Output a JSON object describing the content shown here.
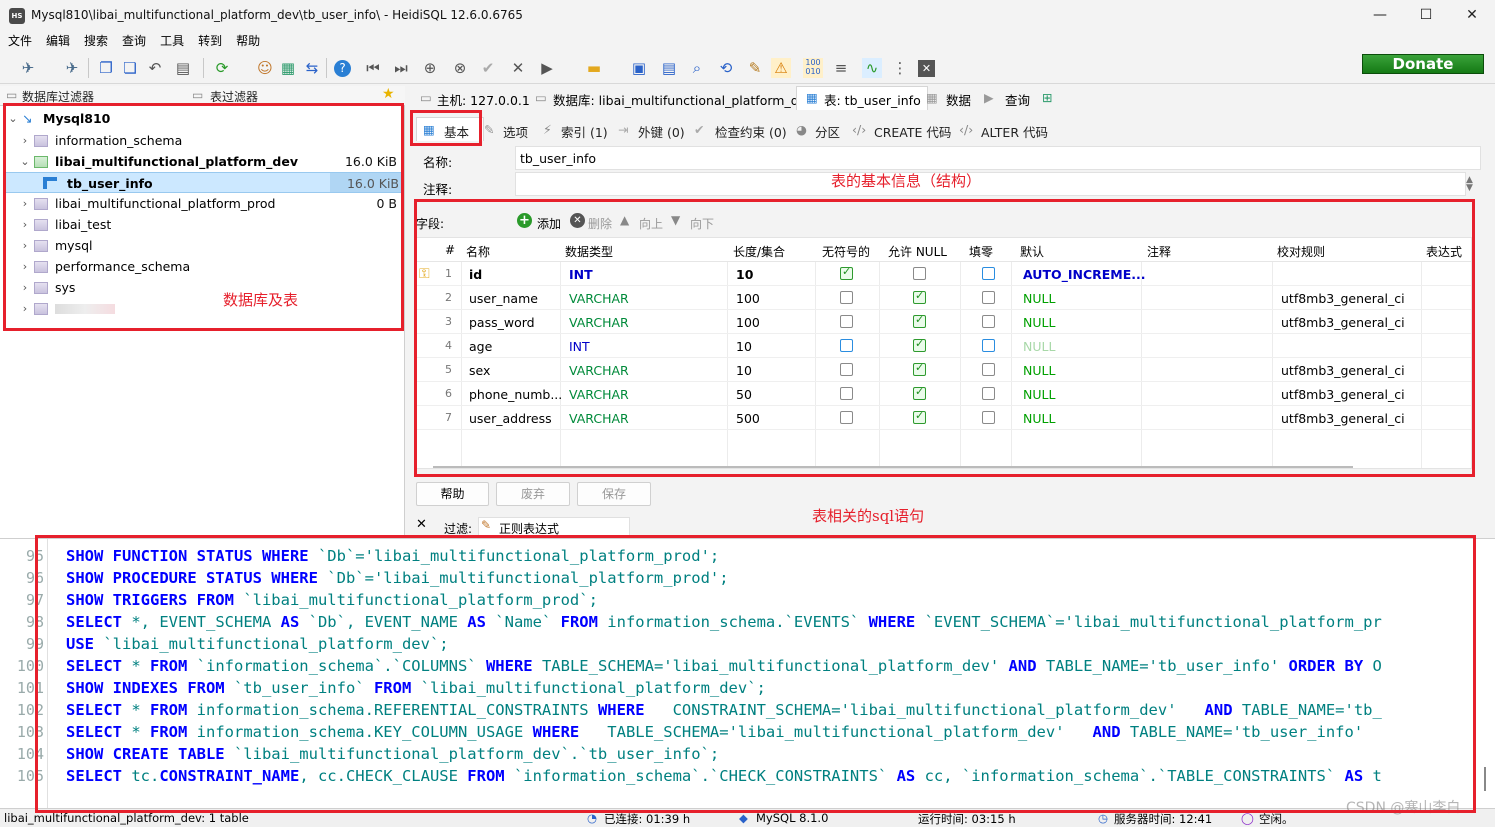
{
  "window": {
    "title": "Mysql810\\libai_multifunctional_platform_dev\\tb_user_info\\ - HeidiSQL 12.6.0.6765",
    "app_badge": "HS"
  },
  "menu": [
    "文件",
    "编辑",
    "搜索",
    "查询",
    "工具",
    "转到",
    "帮助"
  ],
  "donate_label": "Donate",
  "left_filters": {
    "db_filter": "数据库过滤器",
    "table_filter": "表过滤器"
  },
  "tree": {
    "root": "Mysql810",
    "items": [
      {
        "label": "information_schema",
        "size": ""
      },
      {
        "label": "libai_multifunctional_platform_dev",
        "size": "16.0 KiB"
      },
      {
        "label": "tb_user_info",
        "size": "16.0 KiB"
      },
      {
        "label": "libai_multifunctional_platform_prod",
        "size": "0 B"
      },
      {
        "label": "libai_test",
        "size": ""
      },
      {
        "label": "mysql",
        "size": ""
      },
      {
        "label": "performance_schema",
        "size": ""
      },
      {
        "label": "sys",
        "size": ""
      }
    ]
  },
  "tabs": {
    "host": "主机: 127.0.0.1",
    "database": "数据库: libai_multifunctional_platform_dev",
    "table": "表: tb_user_info",
    "data": "数据",
    "query": "查询"
  },
  "subtabs": [
    "基本",
    "选项",
    "索引 (1)",
    "外键 (0)",
    "检查约束 (0)",
    "分区",
    "CREATE 代码",
    "ALTER 代码"
  ],
  "form": {
    "name_label": "名称:",
    "name_value": "tb_user_info",
    "comment_label": "注释:"
  },
  "fields": {
    "label": "字段:",
    "add": "添加",
    "delete": "删除",
    "up": "向上",
    "down": "向下"
  },
  "grid": {
    "headers": [
      "#",
      "名称",
      "数据类型",
      "长度/集合",
      "无符号的",
      "允许 NULL",
      "填零",
      "默认",
      "注释",
      "校对规则",
      "表达式"
    ],
    "rows": [
      {
        "n": "1",
        "name": "id",
        "type": "INT",
        "len": "10",
        "unsigned": true,
        "allownull": false,
        "zerofill": false,
        "default": "AUTO_INCREME...",
        "collation": ""
      },
      {
        "n": "2",
        "name": "user_name",
        "type": "VARCHAR",
        "len": "100",
        "unsigned": false,
        "allownull": true,
        "zerofill": false,
        "default": "NULL",
        "collation": "utf8mb3_general_ci"
      },
      {
        "n": "3",
        "name": "pass_word",
        "type": "VARCHAR",
        "len": "100",
        "unsigned": false,
        "allownull": true,
        "zerofill": false,
        "default": "NULL",
        "collation": "utf8mb3_general_ci"
      },
      {
        "n": "4",
        "name": "age",
        "type": "INT",
        "len": "10",
        "unsigned": false,
        "allownull": true,
        "zerofill": false,
        "default": "NULL",
        "collation": ""
      },
      {
        "n": "5",
        "name": "sex",
        "type": "VARCHAR",
        "len": "10",
        "unsigned": false,
        "allownull": true,
        "zerofill": false,
        "default": "NULL",
        "collation": "utf8mb3_general_ci"
      },
      {
        "n": "6",
        "name": "phone_numb...",
        "type": "VARCHAR",
        "len": "50",
        "unsigned": false,
        "allownull": true,
        "zerofill": false,
        "default": "NULL",
        "collation": "utf8mb3_general_ci"
      },
      {
        "n": "7",
        "name": "user_address",
        "type": "VARCHAR",
        "len": "500",
        "unsigned": false,
        "allownull": true,
        "zerofill": false,
        "default": "NULL",
        "collation": "utf8mb3_general_ci"
      }
    ]
  },
  "buttons": {
    "help": "帮助",
    "discard": "废弃",
    "save": "保存"
  },
  "filter": {
    "label": "过滤:",
    "regex": "正则表达式"
  },
  "annotations": {
    "table_info": "表的基本信息（结构）",
    "db_and_table": "数据库及表",
    "sql": "表相关的sql语句"
  },
  "sql_lines": [
    {
      "n": "95",
      "html": "<b>SHOW FUNCTION STATUS WHERE</b> `Db`='libai_multifunctional_platform_prod';"
    },
    {
      "n": "96",
      "html": "<b>SHOW PROCEDURE STATUS WHERE</b> `Db`='libai_multifunctional_platform_prod';"
    },
    {
      "n": "97",
      "html": "<b>SHOW TRIGGERS FROM</b> `libai_multifunctional_platform_prod`;"
    },
    {
      "n": "98",
      "html": "<b>SELECT</b> *, EVENT_SCHEMA <b>AS</b> `Db`, EVENT_NAME <b>AS</b> `Name` <b>FROM</b> information_schema.`EVENTS` <b>WHERE</b> `EVENT_SCHEMA`='libai_multifunctional_platform_pr"
    },
    {
      "n": "99",
      "html": "<b>USE</b> `libai_multifunctional_platform_dev`;"
    },
    {
      "n": "100",
      "html": "<b>SELECT</b> * <b>FROM</b> `information_schema`.`COLUMNS` <b>WHERE</b> TABLE_SCHEMA='libai_multifunctional_platform_dev' <b>AND</b> TABLE_NAME='tb_user_info' <b>ORDER BY</b> O"
    },
    {
      "n": "101",
      "html": "<b>SHOW INDEXES FROM</b> `tb_user_info` <b>FROM</b> `libai_multifunctional_platform_dev`;"
    },
    {
      "n": "102",
      "html": "<b>SELECT</b> * <b>FROM</b> information_schema.REFERENTIAL_CONSTRAINTS <b>WHERE</b>   CONSTRAINT_SCHEMA='libai_multifunctional_platform_dev'   <b>AND</b> TABLE_NAME='tb_"
    },
    {
      "n": "103",
      "html": "<b>SELECT</b> * <b>FROM</b> information_schema.KEY_COLUMN_USAGE <b>WHERE</b>   TABLE_SCHEMA='libai_multifunctional_platform_dev'   <b>AND</b> TABLE_NAME='tb_user_info'"
    },
    {
      "n": "104",
      "html": "<b>SHOW CREATE TABLE</b> `libai_multifunctional_platform_dev`.`tb_user_info`;"
    },
    {
      "n": "105",
      "html": "<b>SELECT</b> tc.<b>CONSTRAINT_NAME</b>, cc.CHECK_CLAUSE <b>FROM</b> `information_schema`.`CHECK_CONSTRAINTS` <b>AS</b> cc, `information_schema`.`TABLE_CONSTRAINTS` <b>AS</b> t"
    }
  ],
  "status": {
    "left": "libai_multifunctional_platform_dev: 1 table",
    "connected": "已连接: 01:39 h",
    "server": "MySQL 8.1.0",
    "uptime": "运行时间: 03:15 h",
    "server_time": "服务器时间: 12:41",
    "idle": "空闲。"
  },
  "watermark": "CSDN @寒山李白",
  "colors": {
    "accent_red": "#e6202c",
    "keyword_blue": "#0000ff",
    "string_teal": "#008080",
    "selected_row": "#cce8ff"
  }
}
